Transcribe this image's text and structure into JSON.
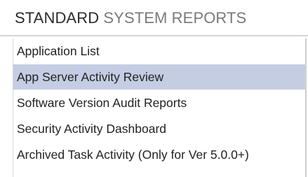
{
  "header": {
    "title_strong": "STANDARD",
    "title_light": "SYSTEM REPORTS"
  },
  "reports": {
    "selected_index": 1,
    "items": [
      {
        "label": "Application List"
      },
      {
        "label": "App Server Activity Review"
      },
      {
        "label": "Software Version Audit Reports"
      },
      {
        "label": "Security Activity Dashboard"
      },
      {
        "label": "Archived Task Activity (Only for Ver 5.0.0+)"
      }
    ]
  }
}
